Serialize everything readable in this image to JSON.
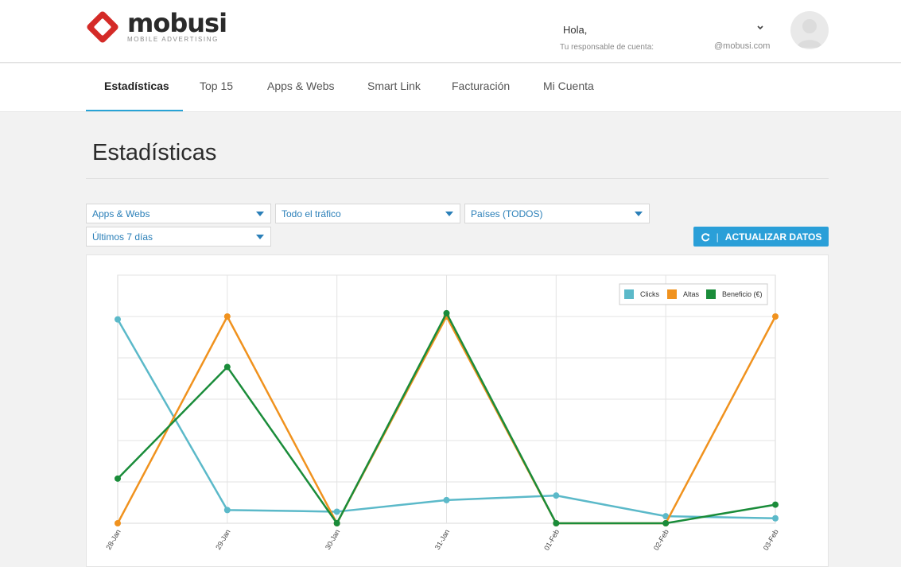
{
  "brand": {
    "name": "mobusi",
    "tagline": "MOBILE ADVERTISING",
    "color": "#d42a27"
  },
  "header": {
    "greeting": "Hola,",
    "account_label": "Tu responsable de cuenta:",
    "email": "@mobusi.com",
    "chevron_icon": "chevron-down-icon"
  },
  "nav": {
    "items": [
      "Estadísticas",
      "Top 15",
      "Apps & Webs",
      "Smart Link",
      "Facturación",
      "Mi Cuenta"
    ],
    "active": "Estadísticas"
  },
  "page": {
    "title": "Estadísticas"
  },
  "filters": {
    "apps": "Apps & Webs",
    "traffic": "Todo el tráfico",
    "countries": "Países (TODOS)",
    "period": "Últimos 7 días"
  },
  "update_button": {
    "icon": "refresh-icon",
    "label": "ACTUALIZAR DATOS"
  },
  "colors": {
    "accent": "#2a9fd8",
    "clicks": "#5bb9c9",
    "altas": "#f0921e",
    "beneficio": "#1a8c3a"
  },
  "chart_data": {
    "type": "line",
    "categories": [
      "28-Jan",
      "29-Jan",
      "30-Jan",
      "31-Jan",
      "01-Feb",
      "02-Feb",
      "03-Feb"
    ],
    "ylim": [
      0,
      6
    ],
    "grid": true,
    "legend_position": "top-right",
    "series": [
      {
        "name": "Clicks",
        "values": [
          4.93,
          0.32,
          0.28,
          0.56,
          0.67,
          0.17,
          0.12
        ]
      },
      {
        "name": "Altas",
        "values": [
          0,
          5.0,
          0,
          5.0,
          0,
          0,
          5.0
        ]
      },
      {
        "name": "Beneficio (€)",
        "values": [
          1.08,
          3.78,
          0,
          5.08,
          0,
          0,
          0.45
        ]
      }
    ]
  }
}
